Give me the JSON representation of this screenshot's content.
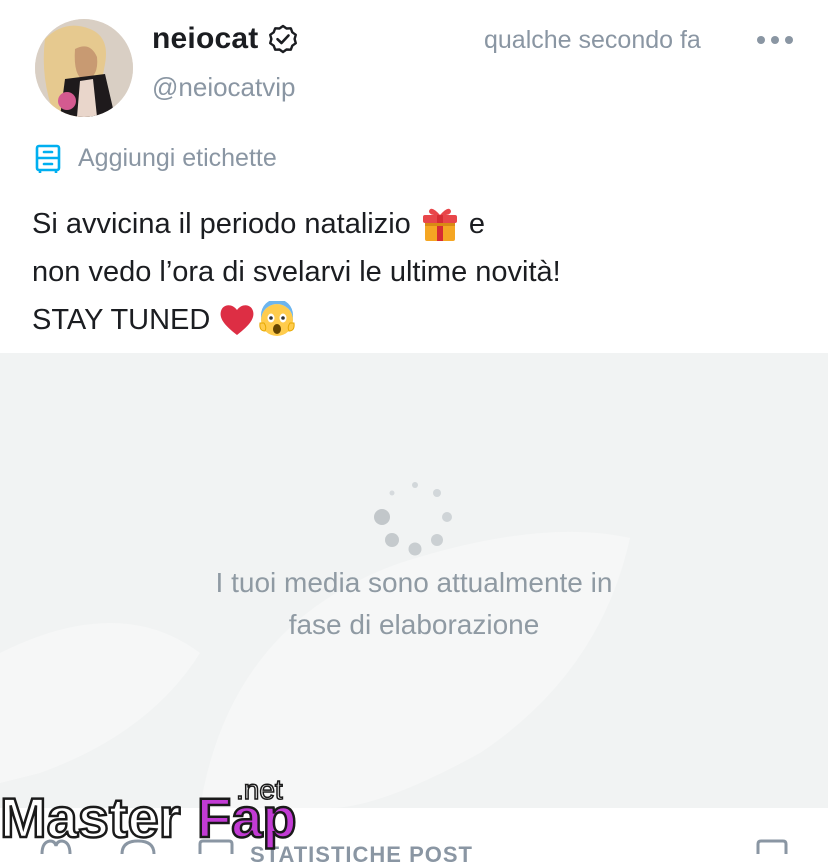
{
  "post": {
    "author": {
      "name": "neiocat",
      "handle": "@neiocatvip",
      "verified": true
    },
    "timestamp": "qualche secondo fa",
    "tags_label": "Aggiungi etichette",
    "text": {
      "line1": "Si avvicina il periodo natalizio",
      "line1_tail": "e",
      "line2": "non vedo l’ora di svelarvi le ultime novità!",
      "line3": "STAY TUNED"
    }
  },
  "media": {
    "status_text": "I tuoi media sono attualmente in fase di elaborazione"
  },
  "footer": {
    "stats_label": "STATISTICHE POST"
  },
  "watermark": {
    "text_a": "Master",
    "text_b": "Fap",
    "text_c": ".net"
  },
  "colors": {
    "muted": "#8a96a3",
    "text": "#1b1d21",
    "accent": "#00aff0",
    "media_bg": "#f1f3f3"
  },
  "icons": [
    "verified-badge-icon",
    "more-options-icon",
    "tag-icon",
    "gift-emoji-icon",
    "heart-emoji-icon",
    "scream-emoji-icon",
    "loading-spinner-icon",
    "like-icon",
    "comment-icon",
    "tip-icon",
    "bookmark-icon"
  ]
}
